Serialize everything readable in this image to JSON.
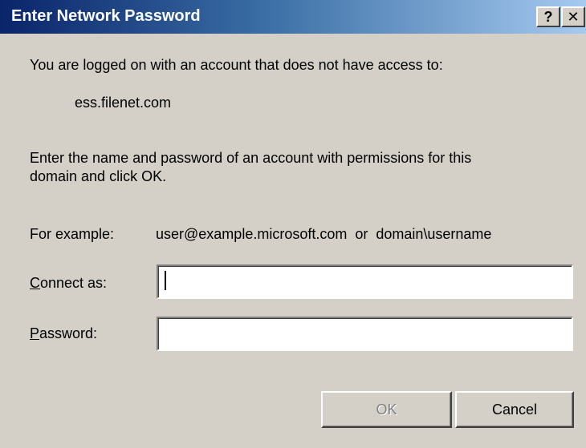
{
  "window": {
    "title": "Enter Network Password",
    "help_glyph": "?",
    "close_glyph": "✕"
  },
  "body": {
    "intro": "You are logged on with an account that does not have access to:",
    "server": "ess.filenet.com",
    "instruction_line1": "Enter the name and password of an account with permissions for this",
    "instruction_line2": "domain and click OK.",
    "example_label": "For example:",
    "example_value": "user@example.microsoft.com  or  domain\\username"
  },
  "form": {
    "connect_as_accel": "C",
    "connect_as_rest": "onnect as:",
    "connect_as_value": "",
    "password_accel": "P",
    "password_rest": "assword:",
    "password_value": ""
  },
  "buttons": {
    "ok_label": "OK",
    "ok_enabled": false,
    "cancel_label": "Cancel"
  },
  "colors": {
    "titlebar_start": "#0a246a",
    "titlebar_end": "#a6caf0",
    "dialog_bg": "#d4d0c8",
    "disabled_text": "#808080"
  }
}
